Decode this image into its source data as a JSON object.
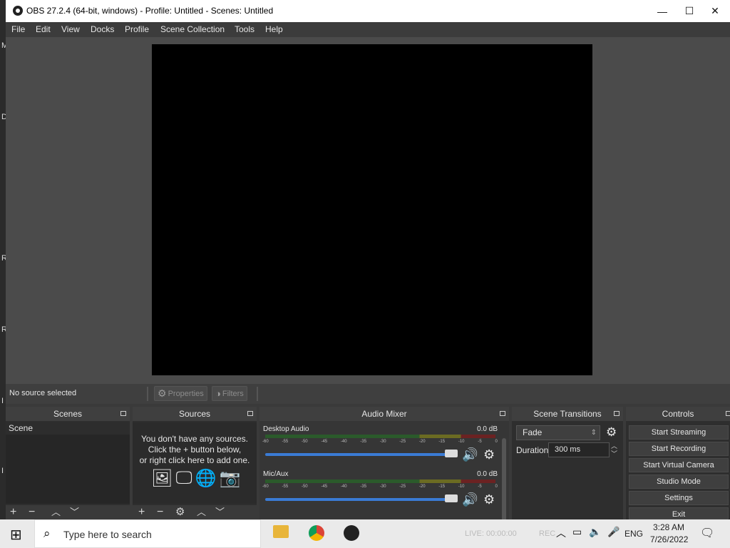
{
  "window": {
    "title": "OBS 27.2.4 (64-bit, windows) - Profile: Untitled - Scenes: Untitled",
    "minimize": "—",
    "maximize": "☐",
    "close": "✕"
  },
  "desktop_strip": [
    "M",
    "D",
    "R",
    "R",
    "I",
    "I"
  ],
  "menu": [
    "File",
    "Edit",
    "View",
    "Docks",
    "Profile",
    "Scene Collection",
    "Tools",
    "Help"
  ],
  "context": {
    "no_source": "No source selected",
    "properties": "Properties",
    "filters": "Filters"
  },
  "scenes": {
    "header": "Scenes",
    "items": [
      "Scene"
    ]
  },
  "sources": {
    "header": "Sources",
    "empty_line1": "You don't have any sources.",
    "empty_line2": "Click the + button below,",
    "empty_line3": "or right click here to add one."
  },
  "mixer": {
    "header": "Audio Mixer",
    "channels": [
      {
        "name": "Desktop Audio",
        "db": "0.0 dB"
      },
      {
        "name": "Mic/Aux",
        "db": "0.0 dB"
      }
    ],
    "scale": [
      "-60",
      "-55",
      "-50",
      "-45",
      "-40",
      "-35",
      "-30",
      "-25",
      "-20",
      "-15",
      "-10",
      "-5",
      "0"
    ]
  },
  "transitions": {
    "header": "Scene Transitions",
    "selected": "Fade",
    "duration_label": "Duration",
    "duration_value": "300 ms"
  },
  "controls": {
    "header": "Controls",
    "buttons": [
      "Start Streaming",
      "Start Recording",
      "Start Virtual Camera",
      "Studio Mode",
      "Settings",
      "Exit"
    ]
  },
  "statusbar": {
    "live": "LIVE: 00:00:00",
    "rec": "REC"
  },
  "taskbar": {
    "search_placeholder": "Type here to search",
    "lang": "ENG",
    "time": "3:28 AM",
    "date": "7/26/2022"
  }
}
